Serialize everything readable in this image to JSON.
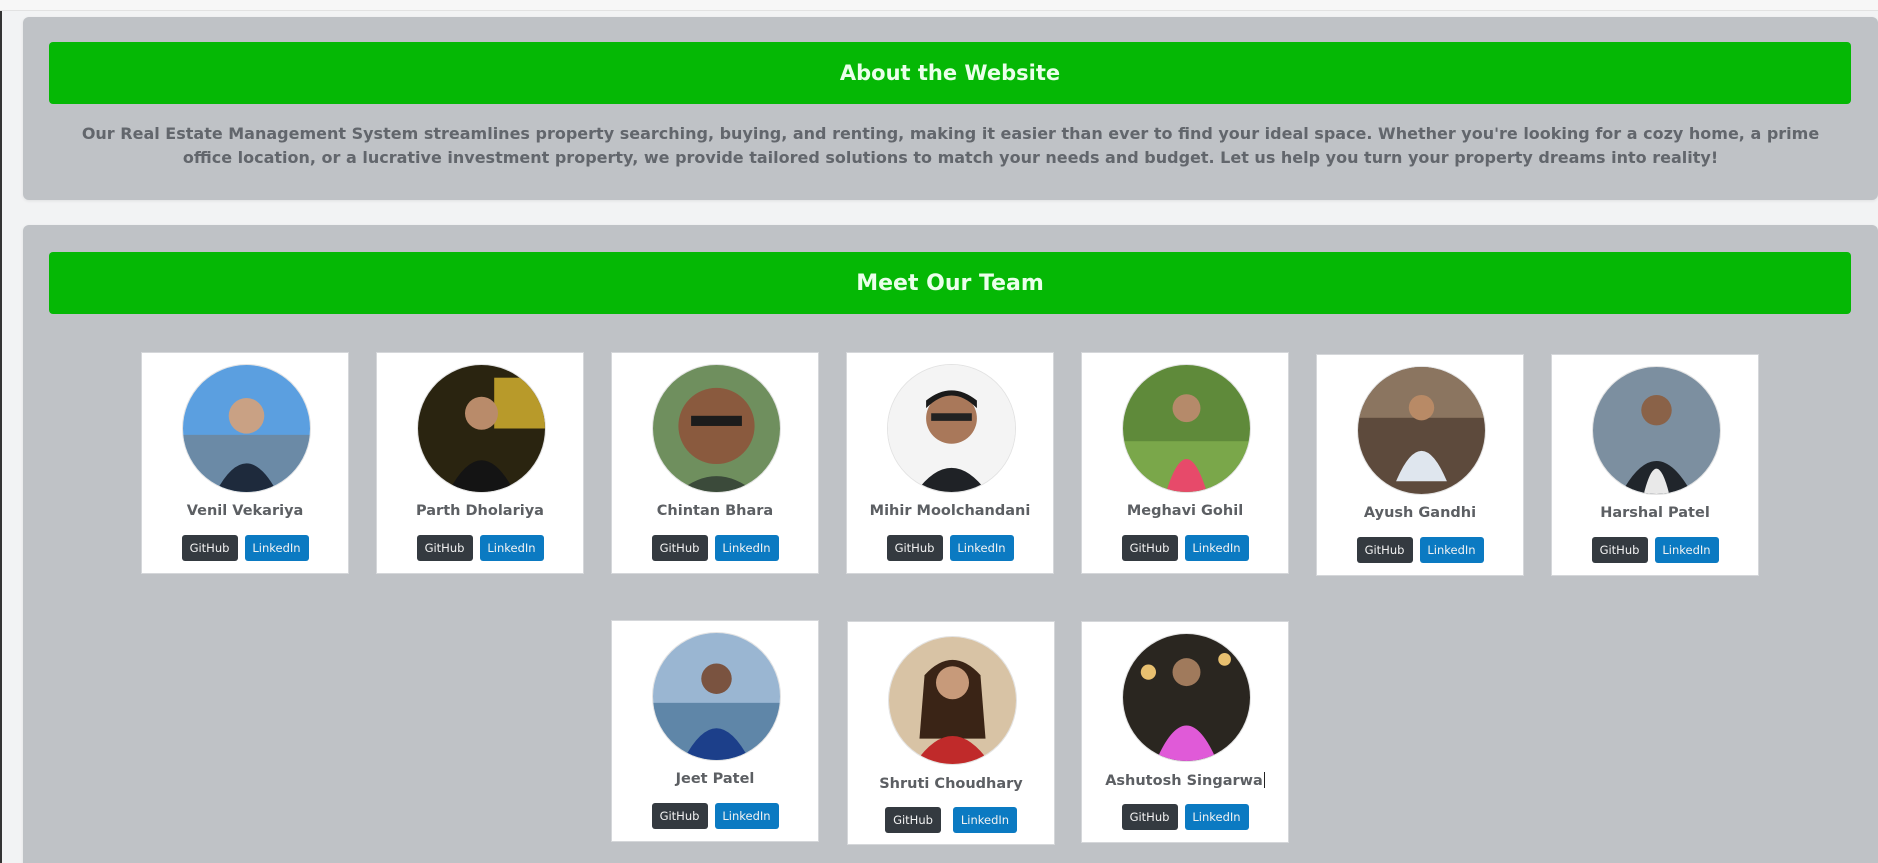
{
  "about": {
    "title": "About the Website",
    "text": "Our Real Estate Management System streamlines property searching, buying, and renting, making it easier than ever to find your ideal space. Whether you're looking for a cozy home, a prime office location, or a lucrative investment property, we provide tailored solutions to match your needs and budget. Let us help you turn your property dreams into reality!"
  },
  "team": {
    "title": "Meet Our Team",
    "github_label": "GitHub",
    "linkedin_label": "LinkedIn",
    "members": [
      {
        "name": "Venil Vekariya"
      },
      {
        "name": "Parth Dholariya"
      },
      {
        "name": "Chintan Bhara"
      },
      {
        "name": "Mihir Moolchandani"
      },
      {
        "name": "Meghavi Gohil"
      },
      {
        "name": "Ayush Gandhi"
      },
      {
        "name": "Harshal Patel"
      },
      {
        "name": "Jeet Patel"
      },
      {
        "name": "Shruti Choudhary"
      },
      {
        "name": "Ashutosh Singarwa"
      }
    ]
  },
  "colors": {
    "banner": "#05b805",
    "section_bg": "#bfc2c6",
    "github_button": "#343a40",
    "linkedin_button": "#0b7ac2"
  }
}
